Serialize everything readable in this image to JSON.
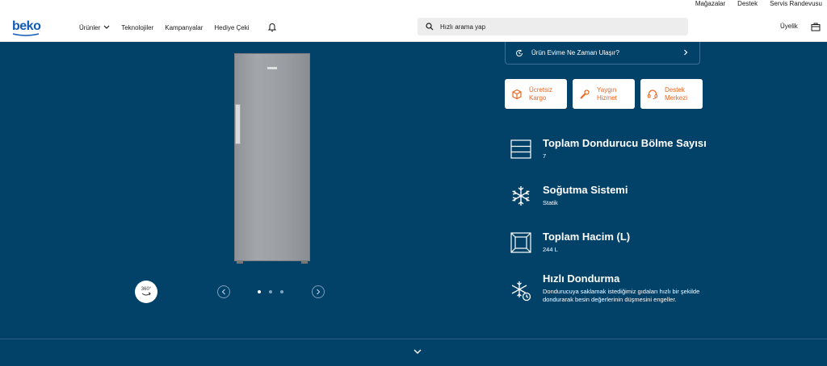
{
  "top_links": [
    "Mağazalar",
    "Destek",
    "Servis Randevusu"
  ],
  "brand": {
    "logo_text": "beko",
    "color": "#0f5bb5"
  },
  "nav": {
    "menu": [
      "Ürünler",
      "Teknolojiler",
      "Kampanyalar",
      "Hediye Çeki"
    ],
    "search_placeholder": "Hızlı arama yap",
    "account_label": "Üyelik"
  },
  "colors": {
    "main_bg": "#024168",
    "accent": "#f0641e"
  },
  "delivery": {
    "label": "Ürün Evime Ne Zaman Ulaşır?"
  },
  "services": [
    {
      "line1": "Ücretsiz",
      "line2": "Kargo",
      "icon": "box-icon"
    },
    {
      "line1": "Yaygın",
      "line2": "Hizmet",
      "icon": "wrench-icon"
    },
    {
      "line1": "Destek",
      "line2": "Merkezi",
      "icon": "headset-icon"
    }
  ],
  "gallery": {
    "rotate_label": "360°",
    "slide_count": 3,
    "active_slide": 1
  },
  "features": [
    {
      "title": "Toplam Dondurucu Bölme Sayısı",
      "value": "7",
      "icon": "drawers-icon"
    },
    {
      "title": "Soğutma Sistemi",
      "value": "Statik",
      "icon": "snowflake-icon"
    },
    {
      "title": "Toplam Hacim (L)",
      "value": "244 L",
      "icon": "volume-icon"
    },
    {
      "title": "Hızlı Dondurma",
      "value": "Dondurucuya saklamak istediğimiz gıdaları hızlı bir şekilde dondurarak besin değerlerinin düşmesini engeller.",
      "icon": "fast-freeze-icon"
    }
  ]
}
